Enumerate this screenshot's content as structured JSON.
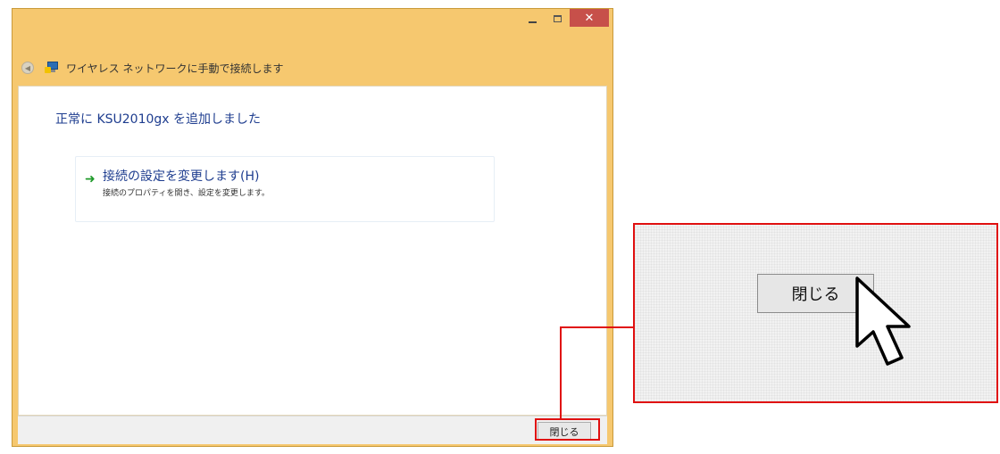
{
  "window": {
    "title": "ワイヤレス ネットワークに手動で接続します",
    "controls": {
      "minimize_icon": "minimize-icon",
      "maximize_icon": "maximize-icon",
      "close_label": "✕"
    }
  },
  "content": {
    "heading": "正常に KSU2010gx を追加しました",
    "option": {
      "title": "接続の設定を変更します(H)",
      "subtitle": "接続のプロパティを開き、設定を変更します。"
    }
  },
  "footer": {
    "close_label": "閉じる"
  },
  "zoom": {
    "close_label": "閉じる"
  },
  "colors": {
    "titlebar": "#f6c86f",
    "highlight": "#e01010",
    "link": "#1e3d8f",
    "arrow": "#1f9a2a",
    "close": "#c7504a"
  }
}
